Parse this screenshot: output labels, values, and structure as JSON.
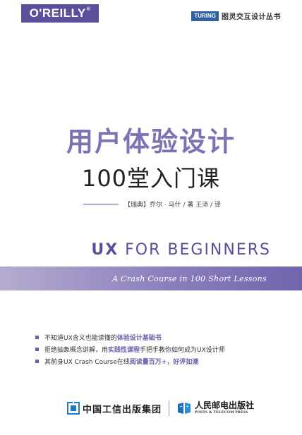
{
  "header": {
    "publisher_logo": "O'REILLY",
    "publisher_logo_mark": "®",
    "series_badge": "TURING",
    "series_name": "图灵交互设计丛书"
  },
  "title": {
    "main": "用户体验设计",
    "sub": "100堂入门课"
  },
  "authors": "【瑞典】乔尔 · 马什 / 著    王沛 / 译",
  "english": {
    "title_bold": "UX",
    "title_rest": " FOR BEGINNERS",
    "subtitle": "A Crash Course in 100 Short Lessons"
  },
  "bullets": [
    {
      "before": "不知道UX含义也能读懂的",
      "highlight": "体验设计基础书",
      "after": ""
    },
    {
      "before": "拒绝抽象概念讲解，用",
      "highlight": "实践性课程",
      "after": "手把手教你如何成为UX设计师"
    },
    {
      "before": "其前身UX Crash Course在线",
      "highlight": "阅读量百万+，好评如潮",
      "after": ""
    }
  ],
  "publishers": {
    "citic": "中国工信出版集团",
    "posts_cn": "人民邮电出版社",
    "posts_en": "POSTS & TELECOM PRESS"
  },
  "colors": {
    "brand_purple": "#5b4e9a",
    "title_purple": "#7f72b4",
    "highlight": "#6d60aa"
  }
}
